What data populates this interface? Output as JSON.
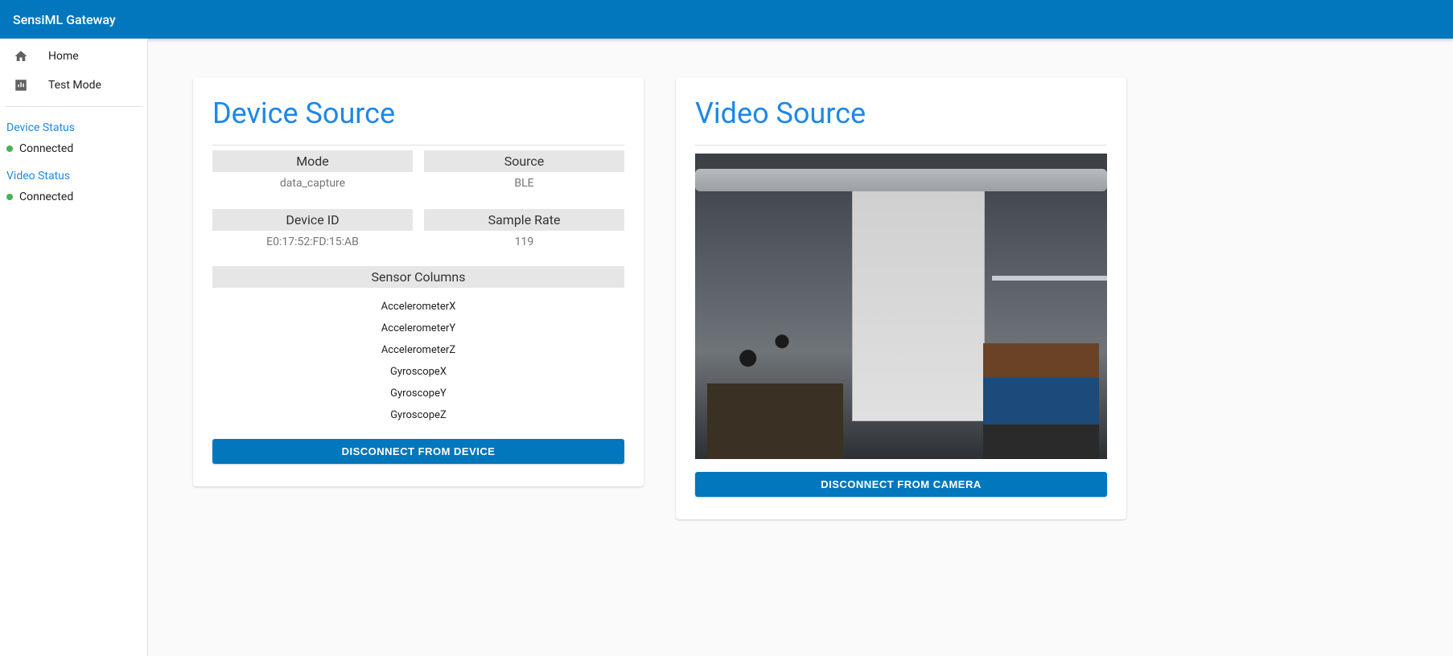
{
  "header": {
    "title": "SensiML Gateway"
  },
  "sidebar": {
    "nav": [
      {
        "label": "Home",
        "icon": "home-icon"
      },
      {
        "label": "Test Mode",
        "icon": "bar-chart-icon"
      }
    ],
    "device_status_title": "Device Status",
    "device_status_value": "Connected",
    "video_status_title": "Video Status",
    "video_status_value": "Connected",
    "status_color": "#4caf50"
  },
  "device_source": {
    "title": "Device Source",
    "fields": {
      "mode_label": "Mode",
      "mode_value": "data_capture",
      "source_label": "Source",
      "source_value": "BLE",
      "device_id_label": "Device ID",
      "device_id_value": "E0:17:52:FD:15:AB",
      "sample_rate_label": "Sample Rate",
      "sample_rate_value": "119"
    },
    "sensor_columns_label": "Sensor Columns",
    "sensor_columns": [
      "AccelerometerX",
      "AccelerometerY",
      "AccelerometerZ",
      "GyroscopeX",
      "GyroscopeY",
      "GyroscopeZ"
    ],
    "disconnect_label": "DISCONNECT FROM DEVICE"
  },
  "video_source": {
    "title": "Video Source",
    "disconnect_label": "DISCONNECT FROM CAMERA"
  },
  "colors": {
    "primary": "#0277bd",
    "accent": "#1e88e5"
  }
}
